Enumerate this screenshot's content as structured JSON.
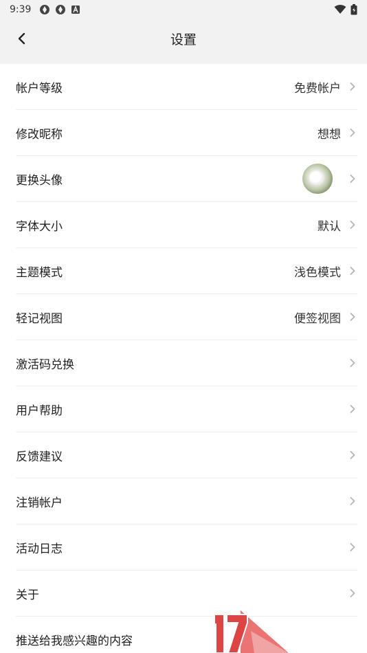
{
  "status_bar": {
    "time": "9:39",
    "left_icons": [
      "app-icon",
      "app-icon",
      "notification-a-icon"
    ],
    "right_icons": [
      "wifi-icon",
      "battery-icon"
    ]
  },
  "app_bar": {
    "title": "设置",
    "back_icon": "chevron-left-icon"
  },
  "settings": {
    "items": [
      {
        "label": "帐户等级",
        "value": "免费帐户"
      },
      {
        "label": "修改昵称",
        "value": "想想"
      },
      {
        "label": "更换头像",
        "value": ""
      },
      {
        "label": "字体大小",
        "value": "默认"
      },
      {
        "label": "主题模式",
        "value": "浅色模式"
      },
      {
        "label": "轻记视图",
        "value": "便签视图"
      },
      {
        "label": "激活码兑换",
        "value": ""
      },
      {
        "label": "用户帮助",
        "value": ""
      },
      {
        "label": "反馈建议",
        "value": ""
      },
      {
        "label": "注销帐户",
        "value": ""
      },
      {
        "label": "活动日志",
        "value": ""
      },
      {
        "label": "关于",
        "value": ""
      },
      {
        "label": "推送给我感兴趣的内容",
        "value": ""
      }
    ]
  },
  "colors": {
    "header_bg": "#f2f2f2",
    "divider": "#efefef",
    "chevron": "#b5b5b5"
  }
}
